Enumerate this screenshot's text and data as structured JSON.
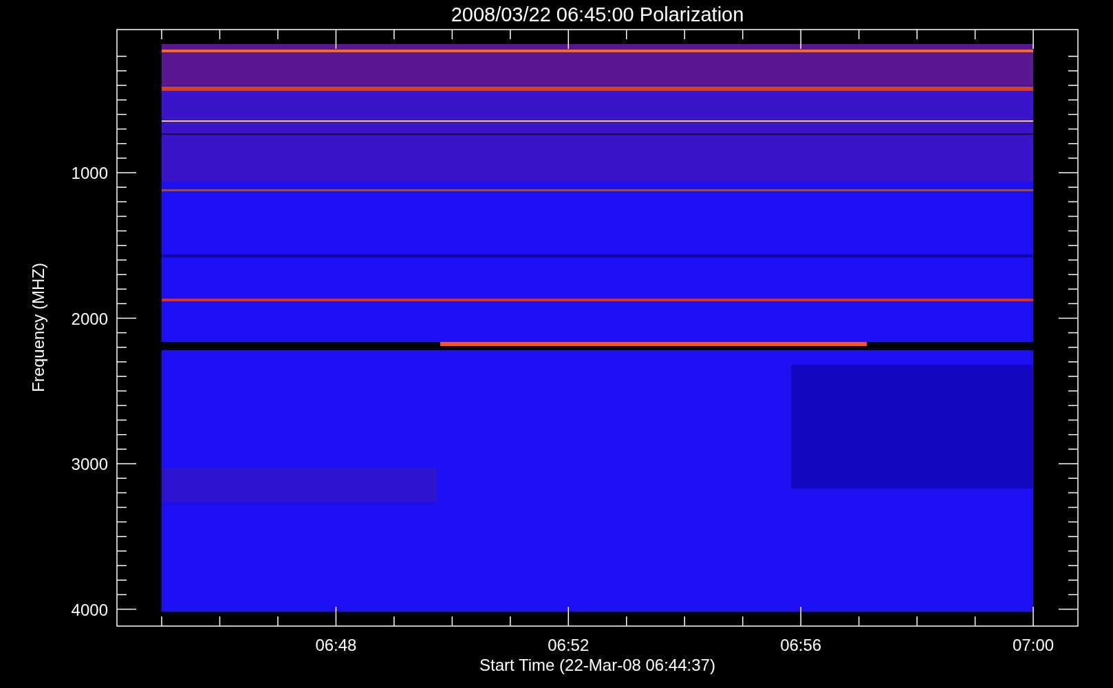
{
  "title": "2008/03/22 06:45:00 Polarization",
  "plot": {
    "ylabel": "Frequency (MHZ)",
    "xlabel": "Start Time (22-Mar-08 06:44:37)",
    "yticks": [
      {
        "label": "1000"
      },
      {
        "label": "2000"
      },
      {
        "label": "3000"
      },
      {
        "label": "4000"
      }
    ],
    "xticks": [
      {
        "label": "06:48"
      },
      {
        "label": "06:52"
      },
      {
        "label": "06:56"
      },
      {
        "label": "07:00"
      }
    ]
  }
}
